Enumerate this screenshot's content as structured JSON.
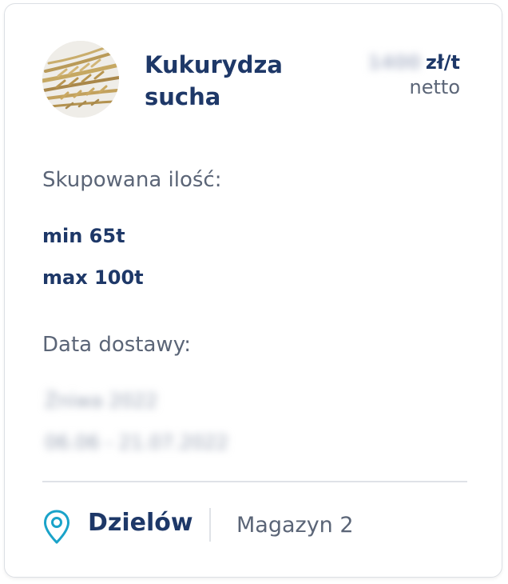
{
  "product": {
    "name": "Kukurydza sucha",
    "price_value": "1400",
    "price_unit": "zł/t",
    "price_type": "netto"
  },
  "quantity": {
    "label": "Skupowana ilość:",
    "min": "min 65t",
    "max": "max 100t"
  },
  "delivery": {
    "label": "Data dostawy:",
    "season": "Żniwa 2022",
    "range": "06.06 - 21.07.2022"
  },
  "location": {
    "city": "Dzielów",
    "warehouse": "Magazyn 2"
  },
  "colors": {
    "primary": "#1e3868",
    "text_secondary": "#5b6577",
    "pin": "#1aa3c9"
  },
  "icons": {
    "location": "map-pin-icon"
  }
}
